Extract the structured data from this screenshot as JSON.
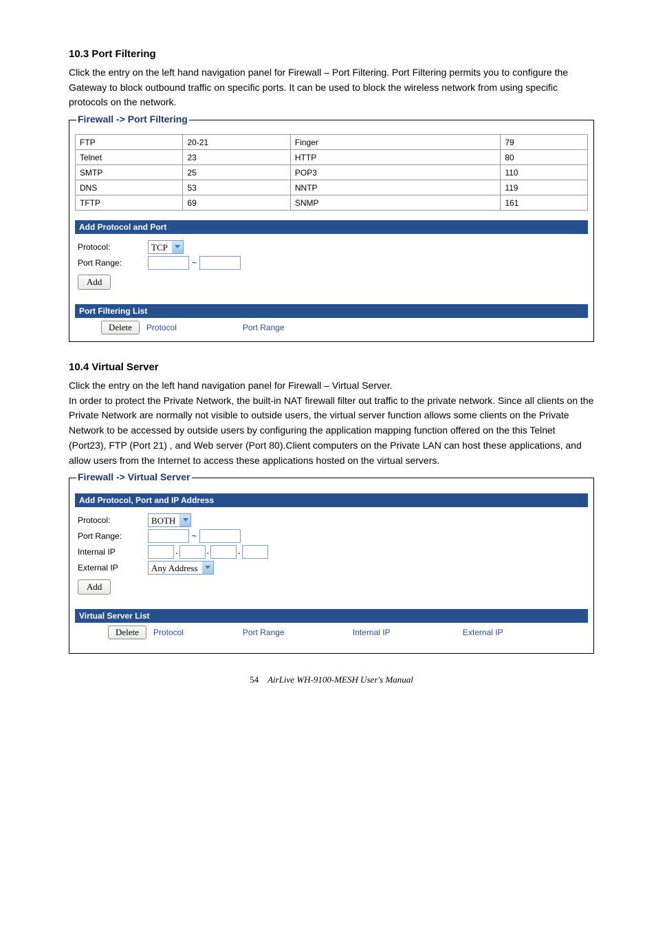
{
  "section1": {
    "heading": "10.3 Port Filtering",
    "paragraph": "Click the entry on the left hand navigation panel for Firewall – Port Filtering. Port Filtering permits you to configure the Gateway to block outbound traffic on specific ports. It can be used to block the wireless network from using specific protocols on the network."
  },
  "panel1": {
    "title": "Firewall -> Port Filtering",
    "rows": [
      {
        "c1": "FTP",
        "c2": "20-21",
        "c3": "Finger",
        "c4": "79"
      },
      {
        "c1": "Telnet",
        "c2": "23",
        "c3": "HTTP",
        "c4": "80"
      },
      {
        "c1": "SMTP",
        "c2": "25",
        "c3": "POP3",
        "c4": "110"
      },
      {
        "c1": "DNS",
        "c2": "53",
        "c3": "NNTP",
        "c4": "119"
      },
      {
        "c1": "TFTP",
        "c2": "69",
        "c3": "SNMP",
        "c4": "161"
      }
    ],
    "addHeader": "Add Protocol and Port",
    "protocolLabel": "Protocol:",
    "protocolValue": "TCP",
    "portRangeLabel": "Port Range:",
    "addBtn": "Add",
    "listHeader": "Port Filtering List",
    "deleteBtn": "Delete",
    "col1": "Protocol",
    "col2": "Port Range"
  },
  "section2": {
    "heading": "10.4 Virtual Server",
    "paragraph": "Click the entry on the left hand navigation panel for Firewall – Virtual Server.\nIn order to protect the Private Network, the built-in NAT firewall filter out traffic to the private network. Since all clients on the Private Network are normally not visible to outside users, the virtual server function allows some clients on the Private Network to be accessed by outside users by configuring the application mapping function offered on the this Telnet (Port23), FTP (Port 21) , and Web server (Port 80).Client computers on the Private LAN can host these applications, and allow users from the Internet to access these applications hosted on the virtual servers."
  },
  "panel2": {
    "title": "Firewall -> Virtual Server",
    "addHeader": "Add Protocol, Port and IP Address",
    "protocolLabel": "Protocol:",
    "protocolValue": "BOTH",
    "portRangeLabel": "Port Range:",
    "internalIpLabel": "Internal IP",
    "externalIpLabel": "External IP",
    "externalIpValue": "Any Address",
    "addBtn": "Add",
    "listHeader": "Virtual Server List",
    "deleteBtn": "Delete",
    "col1": "Protocol",
    "col2": "Port Range",
    "col3": "Internal IP",
    "col4": "External IP"
  },
  "footer": {
    "page": "54",
    "doc": "AirLive WH-9100-MESH User's Manual"
  }
}
